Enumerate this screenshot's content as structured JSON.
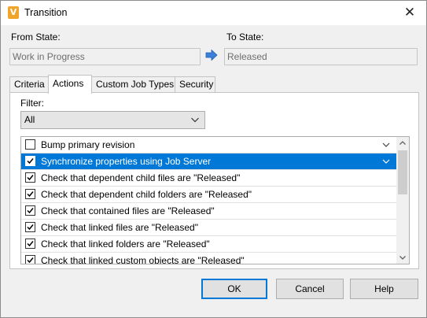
{
  "window": {
    "title": "Transition",
    "app_icon_letter": "V",
    "close_glyph": "✕"
  },
  "from_state": {
    "label": "From State:",
    "value": "Work in Progress"
  },
  "to_state": {
    "label": "To State:",
    "value": "Released"
  },
  "arrow_icon": "right-arrow-icon",
  "tabs": [
    {
      "label": "Criteria",
      "active": false
    },
    {
      "label": "Actions",
      "active": true
    },
    {
      "label": "Custom Job Types",
      "active": false
    },
    {
      "label": "Security",
      "active": false
    }
  ],
  "filter": {
    "label": "Filter:",
    "selected": "All"
  },
  "actions": [
    {
      "label": "Bump primary revision",
      "checked": false,
      "selected": false
    },
    {
      "label": "Synchronize properties using Job Server",
      "checked": true,
      "selected": true
    },
    {
      "label": "Check that dependent child files are \"Released\"",
      "checked": true,
      "selected": false
    },
    {
      "label": "Check that dependent child folders are \"Released\"",
      "checked": true,
      "selected": false
    },
    {
      "label": "Check that contained files are \"Released\"",
      "checked": true,
      "selected": false
    },
    {
      "label": "Check that linked files are \"Released\"",
      "checked": true,
      "selected": false
    },
    {
      "label": "Check that linked folders are \"Released\"",
      "checked": true,
      "selected": false
    },
    {
      "label": "Check that linked custom objects are \"Released\"",
      "checked": true,
      "selected": false
    }
  ],
  "buttons": {
    "ok": "OK",
    "cancel": "Cancel",
    "help": "Help"
  },
  "colors": {
    "selection": "#0078d7",
    "accent": "#0078d7",
    "app_icon": "#f0a42a"
  }
}
